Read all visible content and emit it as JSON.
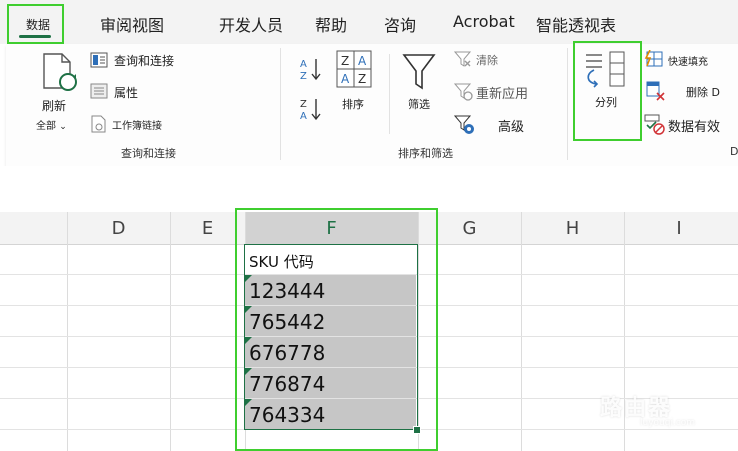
{
  "tabs": [
    {
      "label": "数据",
      "active": true
    },
    {
      "label": "审阅视图"
    },
    {
      "label": "开发人员"
    },
    {
      "label": "帮助"
    },
    {
      "label": "咨询"
    },
    {
      "label": "Acrobat"
    },
    {
      "label": "智能透视表"
    }
  ],
  "ribbon": {
    "query_group": {
      "refresh_label": "刷新",
      "refresh_all_label": "全部",
      "query_connect_label": "查询和连接",
      "properties_label": "属性",
      "workbook_links_label": "工作簿链接",
      "group_label": "查询和连接"
    },
    "sort_group": {
      "sort_label": "排序",
      "filter_label": "筛选",
      "clear_label": "清除",
      "reapply_label": "重新应用",
      "advanced_label": "高级",
      "group_label": "排序和筛选"
    },
    "data_tools": {
      "text_to_columns_label": "分列",
      "flash_fill_label": "快速填充",
      "remove_dup_label": "删除 D",
      "validation_label": "数据有效",
      "group_label_partial": "D"
    }
  },
  "grid": {
    "columns": [
      "D",
      "E",
      "F",
      "G",
      "H",
      "I"
    ],
    "selected_column": "F",
    "header_cell": "SKU 代码",
    "values": [
      "123444",
      "765442",
      "676778",
      "776874",
      "764334"
    ]
  },
  "watermark": {
    "text": "路由器",
    "sub": "luyouqi.com"
  },
  "colors": {
    "accent": "#1e7145",
    "highlight": "#3fce2f",
    "selection_fill": "#c6c6c6"
  }
}
